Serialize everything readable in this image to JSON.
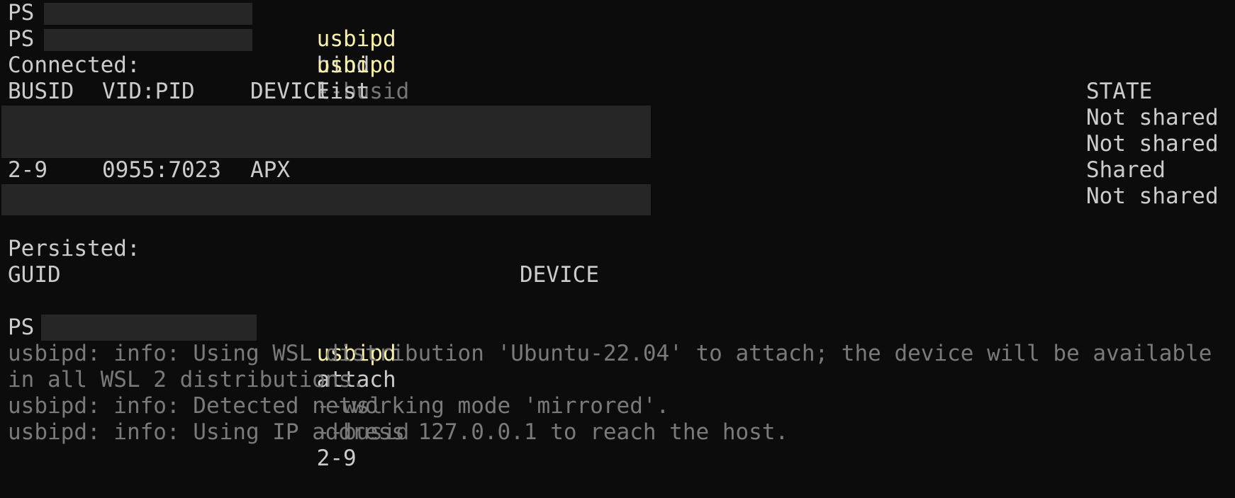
{
  "terminal": {
    "colors": {
      "background": "#0c0c0c",
      "foreground": "#cccccc",
      "command": "#f9f1a5",
      "parameter": "#767676",
      "info_text": "#7a7a7a",
      "redaction": "#262626"
    },
    "prompt_prefix": "PS",
    "commands": [
      {
        "cmd": "usbipd",
        "args": [
          {
            "text": "bind",
            "kind": "plain"
          },
          {
            "text": "--busid",
            "kind": "param"
          },
          {
            "text": "2-9",
            "kind": "plain"
          }
        ]
      },
      {
        "cmd": "usbipd",
        "args": [
          {
            "text": "list",
            "kind": "plain"
          }
        ]
      },
      {
        "cmd": "usbipd",
        "args": [
          {
            "text": "attach",
            "kind": "plain"
          },
          {
            "text": "--wsl",
            "kind": "param"
          },
          {
            "text": "--busid",
            "kind": "param"
          },
          {
            "text": "2-9",
            "kind": "plain"
          }
        ]
      }
    ],
    "list_output": {
      "connected_heading": "Connected:",
      "headers": {
        "busid": "BUSID",
        "vidpid": "VID:PID",
        "device": "DEVICE",
        "state": "STATE"
      },
      "rows": [
        {
          "busid": "",
          "vidpid": "",
          "device": "",
          "state": "Not shared",
          "redacted": true
        },
        {
          "busid": "",
          "vidpid": "",
          "device": "",
          "state": "Not shared",
          "redacted": true
        },
        {
          "busid": "2-9",
          "vidpid": "0955:7023",
          "device": "APX",
          "state": "Shared",
          "redacted": false
        },
        {
          "busid": "",
          "vidpid": "",
          "device": "",
          "state": "Not shared",
          "redacted": true
        }
      ],
      "persisted_heading": "Persisted:",
      "persisted_headers": {
        "guid": "GUID",
        "device": "DEVICE"
      }
    },
    "attach_output": [
      "usbipd: info: Using WSL distribution 'Ubuntu-22.04' to attach; the device will be available",
      "in all WSL 2 distributions.",
      "usbipd: info: Detected networking mode 'mirrored'.",
      "usbipd: info: Using IP address 127.0.0.1 to reach the host."
    ]
  }
}
